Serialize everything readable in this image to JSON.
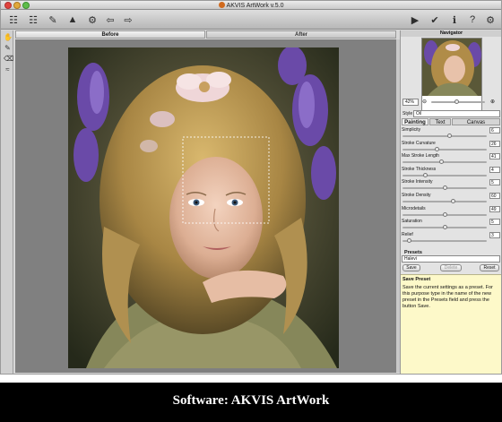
{
  "window": {
    "title": "AKVIS ArtWork v.5.0"
  },
  "toolbar": {
    "icons": [
      "open-icon",
      "save-icon",
      "print-icon",
      "share-icon",
      "plugin-icon",
      "undo-icon",
      "redo-icon",
      "run-icon",
      "apply-icon",
      "info-icon",
      "help-icon",
      "settings-icon"
    ]
  },
  "view_tabs": {
    "before": "Before",
    "after": "After"
  },
  "navigator": {
    "title": "Navigator",
    "zoom": "42%"
  },
  "style": {
    "label": "Style",
    "value": "Oil"
  },
  "subtabs": [
    "Painting",
    "Text",
    "Canvas"
  ],
  "params": [
    {
      "label": "Simplicity",
      "value": "6",
      "level": 0.55
    },
    {
      "label": "Stroke Curvature",
      "value": "26",
      "level": 0.4
    },
    {
      "label": "Max Stroke Length",
      "value": "41",
      "level": 0.45
    },
    {
      "label": "Stroke Thickness",
      "value": "4",
      "level": 0.25
    },
    {
      "label": "Stroke Intensity",
      "value": "5",
      "level": 0.5
    },
    {
      "label": "Stroke Density",
      "value": "60",
      "level": 0.6
    },
    {
      "label": "Microdetails",
      "value": "49",
      "level": 0.5
    },
    {
      "label": "Saturation",
      "value": "5",
      "level": 0.5
    },
    {
      "label": "Relief",
      "value": "3",
      "level": 0.05
    }
  ],
  "presets": {
    "label": "Presets",
    "value": "Halevi",
    "save": "Save",
    "delete": "Delete",
    "reset": "Reset"
  },
  "help": {
    "title": "Save Preset",
    "text": "Save the current settings as a preset. For this purpose type in the name of the new preset in the Presets field and press the button Save."
  },
  "caption": "Software: AKVIS ArtWork"
}
